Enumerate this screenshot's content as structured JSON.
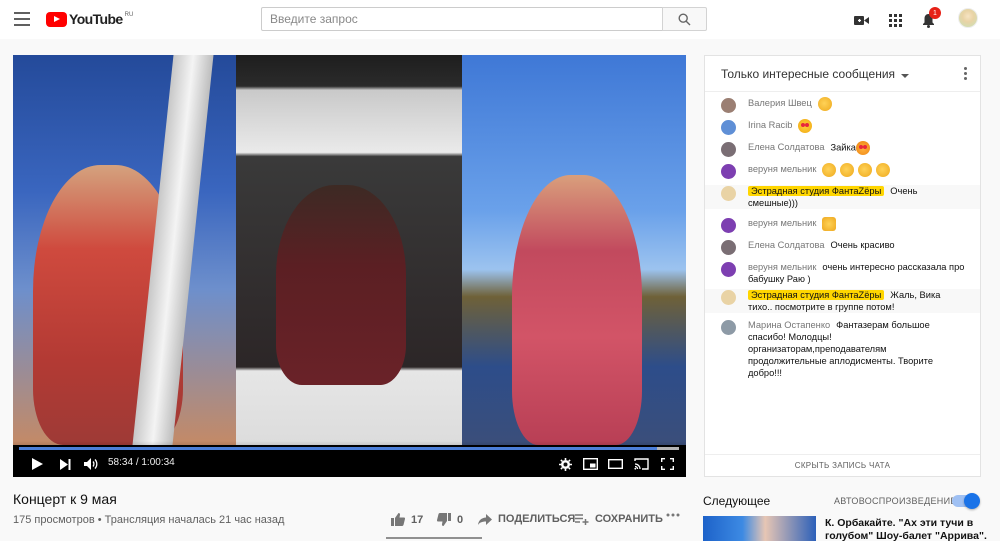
{
  "header": {
    "logo_text": "YouTube",
    "logo_region": "RU",
    "search_placeholder": "Введите запрос",
    "notifications_count": "1"
  },
  "player": {
    "time_current": "58:34",
    "time_separator": "/",
    "time_total": "1:00:34",
    "progress_fraction": 0.967
  },
  "video": {
    "title": "Концерт к 9 мая",
    "views": "175 просмотров",
    "dot": "•",
    "stream_info": "Трансляция началась 21 час назад",
    "likes": "17",
    "dislikes": "0",
    "share_label": "ПОДЕЛИТЬСЯ",
    "save_label": "СОХРАНИТЬ"
  },
  "chat": {
    "header": "Только интересные сообщения",
    "hide_label": "СКРЫТЬ ЗАПИСЬ ЧАТА",
    "messages": [
      {
        "author": "Валерия Швец",
        "text": "",
        "emoji": [
          "hand"
        ]
      },
      {
        "author": "Irina Racib",
        "text": "",
        "emoji": [
          "heart-eyes"
        ]
      },
      {
        "author": "Елена Солдатова",
        "text": "Зайка",
        "emoji": [
          "cat"
        ]
      },
      {
        "author": "веруня мельник",
        "text": "",
        "emoji": [
          "hand",
          "hand",
          "hand",
          "hand"
        ]
      },
      {
        "author": "Эстрадная студия ФантаZёры",
        "text": "Очень смешные)))",
        "owner": true
      },
      {
        "author": "веруня мельник",
        "text": "",
        "emoji": [
          "thumb"
        ]
      },
      {
        "author": "Елена Солдатова",
        "text": "Очень красиво"
      },
      {
        "author": "веруня мельник",
        "text": "очень интересно рассказала про бабушку Раю )"
      },
      {
        "author": "Эстрадная студия ФантаZёры",
        "text": "Жаль, Вика тихо.. посмотрите в группе потом!",
        "owner": true
      },
      {
        "author": "Марина Остапенко",
        "text": "Фантазерам большое спасибо! Молодцы! организаторам,преподавателям продолжительные аплодисменты. Творите добро!!!"
      }
    ]
  },
  "sidebar": {
    "up_next": "Следующее",
    "autoplay": "АВТОВОСПРОИЗВЕДЕНИЕ",
    "next_title": "К. Орбакайте. \"Ах эти тучи в голубом\" Шоу-балет \"Аррива\"."
  }
}
